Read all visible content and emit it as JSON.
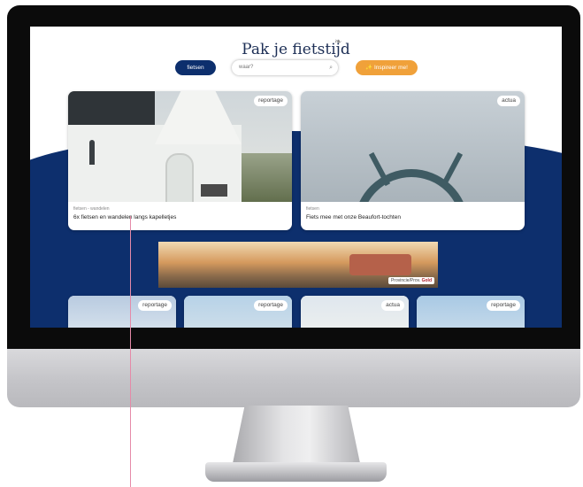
{
  "site": {
    "title": "Pak je fietstijd"
  },
  "controls": {
    "filter_button": "fietsen",
    "search_placeholder": "waar?",
    "inspire_button": "Inspireer me!"
  },
  "featured_cards": [
    {
      "badge": "reportage",
      "category": "fietsen - wandelen",
      "title": "6x fietsen en wandelen langs kapelletjes"
    },
    {
      "badge": "actua",
      "category": "fietsen",
      "title": "Fiets mee met onze Beaufort-tochten"
    }
  ],
  "banner": {
    "logo_prefix": "Provincie/Prov.",
    "logo_brand": "Gold"
  },
  "thumb_cards": [
    {
      "badge": "reportage"
    },
    {
      "badge": "reportage"
    },
    {
      "badge": "actua"
    },
    {
      "badge": "reportage"
    }
  ],
  "colors": {
    "navy": "#0d2f6d",
    "orange": "#f0a13a",
    "monitor_bezel": "#0b0b0b"
  }
}
